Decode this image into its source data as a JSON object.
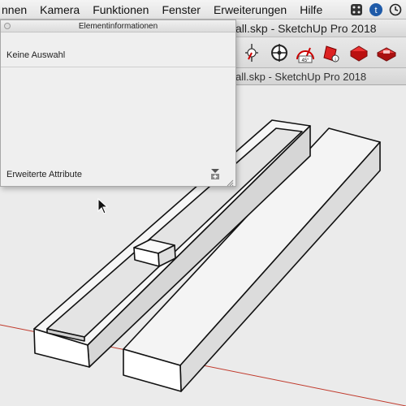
{
  "menubar": {
    "items": [
      "nnen",
      "Kamera",
      "Funktionen",
      "Fenster",
      "Erweiterungen",
      "Hilfe"
    ]
  },
  "window": {
    "title": "all.skp - SketchUp Pro 2018",
    "subtitle": "all.skp - SketchUp Pro 2018"
  },
  "entity_info": {
    "title": "Elementinformationen",
    "selection": "Keine Auswahl",
    "advanced_attributes": "Erweiterte Attribute"
  },
  "colors": {
    "axis_red": "#c0392b",
    "menubar": "#e8e8e8",
    "viewport": "#ebebeb"
  }
}
